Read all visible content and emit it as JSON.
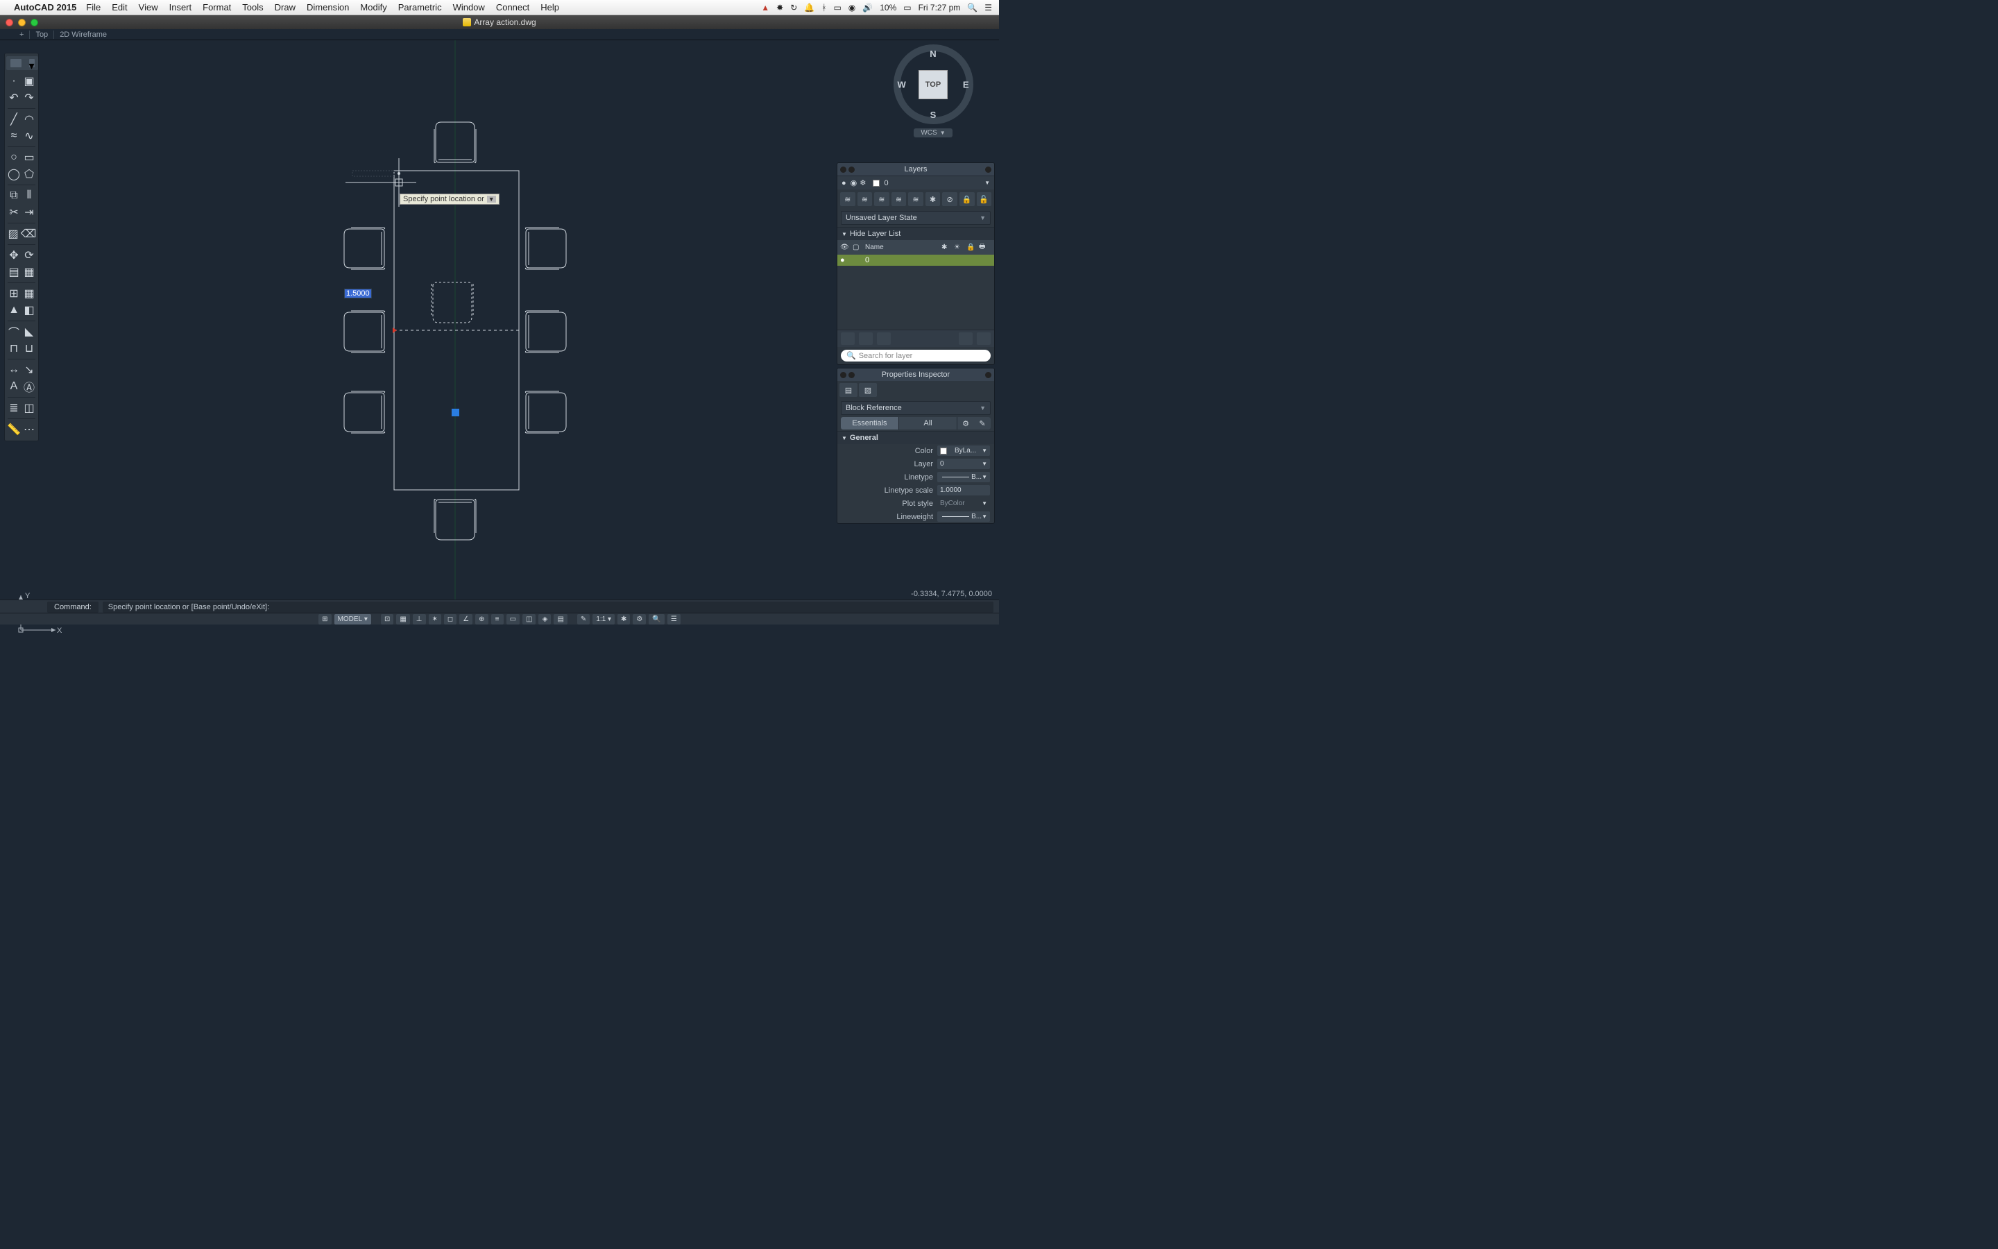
{
  "menubar": {
    "app": "AutoCAD 2015",
    "items": [
      "File",
      "Edit",
      "View",
      "Insert",
      "Format",
      "Tools",
      "Draw",
      "Dimension",
      "Modify",
      "Parametric",
      "Window",
      "Connect",
      "Help"
    ],
    "right": {
      "battery": "10%",
      "clock": "Fri 7:27 pm"
    }
  },
  "titlebar": {
    "filename": "Array action.dwg"
  },
  "viewport": {
    "tab_plus": "+",
    "view": "Top",
    "style": "2D Wireframe"
  },
  "viewcube": {
    "face": "TOP",
    "n": "N",
    "s": "S",
    "e": "E",
    "w": "W",
    "wcs": "WCS"
  },
  "layers_panel": {
    "title": "Layers",
    "current_layer": "0",
    "state": "Unsaved Layer State",
    "hide": "Hide Layer List",
    "col_name": "Name",
    "row_name": "0",
    "search_placeholder": "Search for layer"
  },
  "props_panel": {
    "title": "Properties Inspector",
    "type": "Block Reference",
    "seg_essentials": "Essentials",
    "seg_all": "All",
    "section": "General",
    "rows": {
      "color_lbl": "Color",
      "color_val": "ByLa...",
      "layer_lbl": "Layer",
      "layer_val": "0",
      "linetype_lbl": "Linetype",
      "linetype_val": "B...",
      "ltscale_lbl": "Linetype scale",
      "ltscale_val": "1.0000",
      "plotstyle_lbl": "Plot style",
      "plotstyle_val": "ByColor",
      "lineweight_lbl": "Lineweight",
      "lineweight_val": "B..."
    }
  },
  "command": {
    "label": "Command:",
    "text": "Specify point location or [Base point/Undo/eXit]:"
  },
  "status": {
    "model": "MODEL",
    "scale": "1:1",
    "coords": "-0.3334, 7.4775, 0.0000"
  },
  "canvas": {
    "tooltip": "Specify point location or",
    "dim_value": "1.5000"
  }
}
